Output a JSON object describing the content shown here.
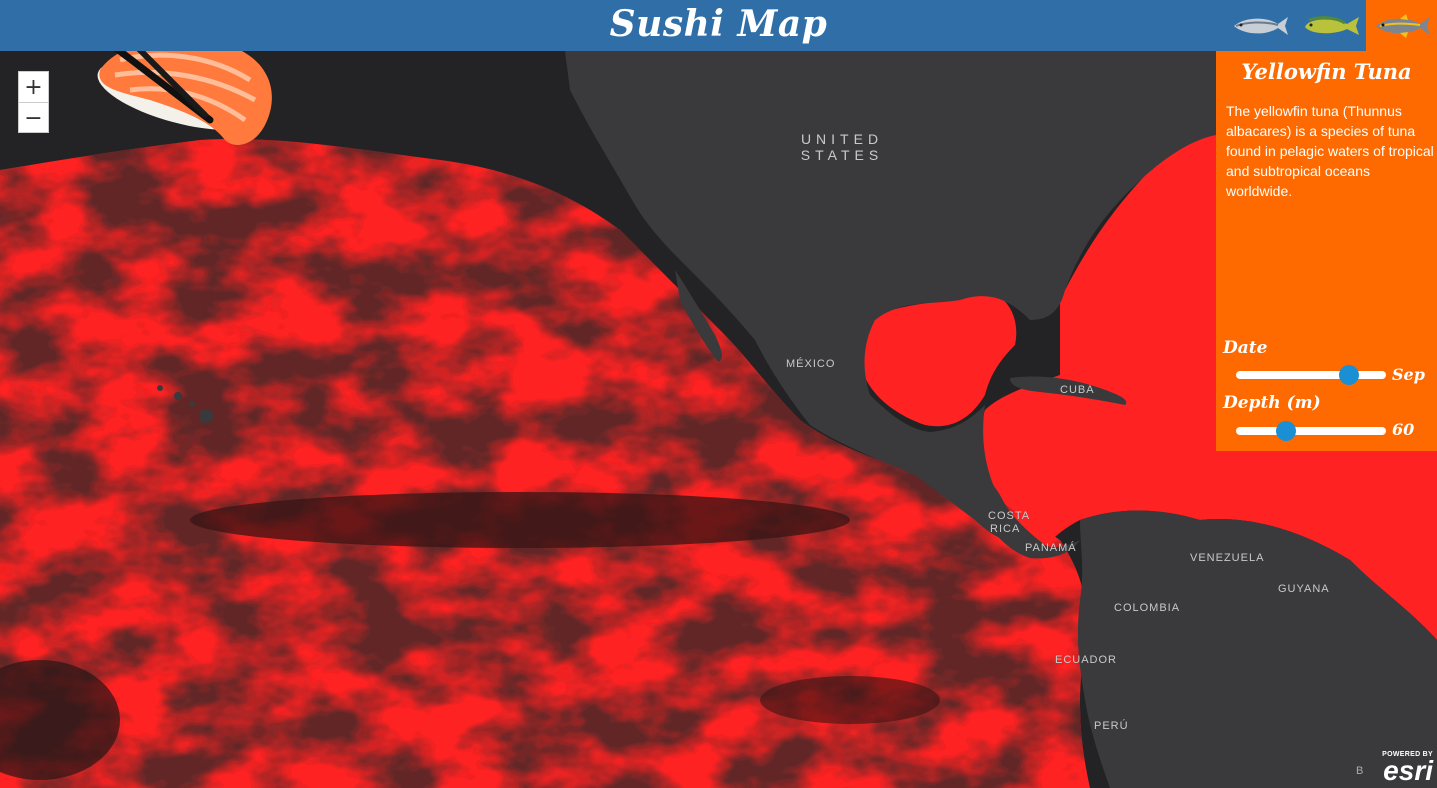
{
  "app": {
    "title": "Sushi Map"
  },
  "fish_tabs": [
    {
      "name": "albacore",
      "icon": "albacore-tuna-icon",
      "active": false
    },
    {
      "name": "mahi",
      "icon": "mahi-mahi-icon",
      "active": false
    },
    {
      "name": "yellowfin",
      "icon": "yellowfin-tuna-icon",
      "active": true
    }
  ],
  "zoom": {
    "in_label": "+",
    "out_label": "−"
  },
  "panel": {
    "title": "Yellowfin Tuna",
    "description": "The yellowfin tuna (Thunnus albacares) is a species of tuna found in pelagic waters of tropical and subtropical oceans worldwide.",
    "date": {
      "label": "Date",
      "value": "Sep",
      "level": 0.75
    },
    "depth": {
      "label": "Depth (m)",
      "value": "60",
      "level": 0.33
    }
  },
  "map_labels": {
    "united_states_1": "UNITED",
    "united_states_2": "STATES",
    "mexico": "MÉXICO",
    "cuba": "CUBA",
    "costa_1": "COSTA",
    "costa_2": "RICA",
    "panama": "PANAMÁ",
    "venezuela": "VENEZUELA",
    "guyana": "GUYANA",
    "colombia": "COLOMBIA",
    "ecuador": "ECUADOR",
    "peru": "PERÚ"
  },
  "attribution": "B",
  "esri": {
    "powered_by": "POWERED BY",
    "word": "esri"
  },
  "colors": {
    "header": "#2f6ea6",
    "panel": "#ff6a00",
    "habitat": "#ff2020",
    "land": "#3a3a3c",
    "ocean": "#242426",
    "slider_thumb": "#1b8fd4"
  }
}
